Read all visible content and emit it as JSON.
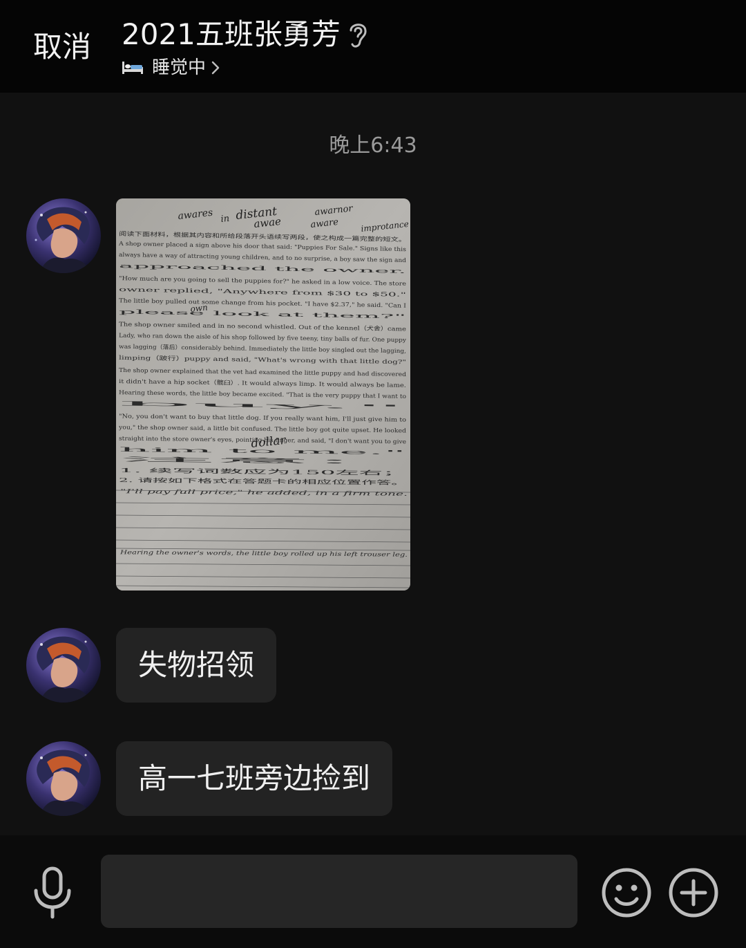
{
  "header": {
    "cancel_label": "取消",
    "title": "2021五班张勇芳",
    "status_text": "睡觉中",
    "status_icon": "bed-icon",
    "mode_icon": "ear-icon"
  },
  "messages": {
    "timestamp": "晚上6:43",
    "items": [
      {
        "type": "image",
        "description_icon": "worksheet-photo"
      },
      {
        "type": "text",
        "text": "失物招领"
      },
      {
        "type": "text",
        "text": "高一七班旁边捡到"
      }
    ]
  },
  "input_bar": {
    "placeholder": "",
    "value": "",
    "icons": [
      "microphone-icon",
      "emoji-icon",
      "plus-icon"
    ]
  },
  "photo_text": {
    "lines": [
      "阅读下面材料，根据其内容和所给段落开头语续写两段，使之构成一篇完整的短文。",
      "A shop owner placed a sign above his door that said: \"Puppies For Sale.\" Signs like this",
      "always have a way of attracting young children, and to no surprise, a boy saw the sign and",
      "approached the owner.",
      "\"How much are you going to sell the puppies for?\" he asked in a low voice. The store",
      "owner replied, \"Anywhere from $30 to $50.\"",
      "The little boy pulled out some change from his pocket. \"I have $2.37,\" he said. \"Can I",
      "please look at them?\"",
      "The shop owner smiled and in no second whistled. Out of the kennel（犬舍）came",
      "Lady, who ran down the aisle of his shop followed by five teeny, tiny balls of fur. One puppy",
      "was lagging（落后）considerably behind. Immediately the little boy singled out the lagging,",
      "limping（跛行）puppy and said, \"What's wrong with that little dog?\"",
      "The shop owner explained that the vet had examined the little puppy and had discovered",
      "it didn't have a hip socket（髋臼）. It would always limp. It would always be lame.",
      "Hearing these words, the little boy became excited. \"That is the very puppy that I want to",
      "buy.\"",
      "\"No, you don't want to buy that little dog. If you really want him, I'll just give him to",
      "you,\" the shop owner said, a little bit confused. The little boy got quite upset. He looked",
      "straight into the store owner's eyes, pointing his finger, and said, \"I don't want you to give",
      "him to me.\"",
      "注意：",
      "1. 续写词数应为150左右；",
      "2. 请按如下格式在答题卡的相应位置作答。",
      "\"I'll pay full price,\" he added, in a firm tone.",
      "Hearing the owner's words, the little boy rolled up his left trouser leg."
    ],
    "handwriting": [
      "awares",
      "in",
      "distant",
      "awae",
      "awarnor",
      "aware",
      "improtance",
      "own",
      "dollar"
    ]
  }
}
